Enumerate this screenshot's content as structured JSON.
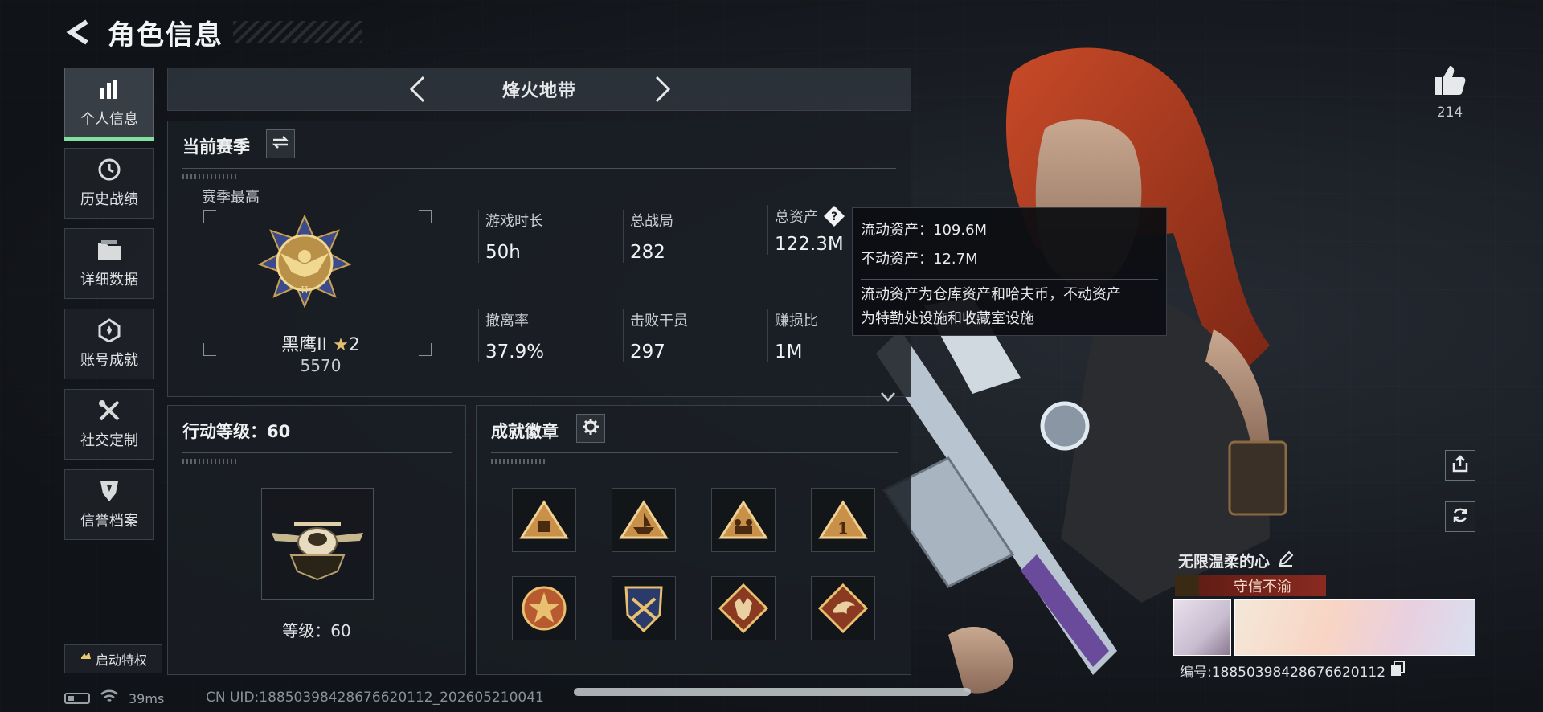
{
  "header": {
    "title": "角色信息"
  },
  "sidebar": {
    "items": [
      {
        "label": "个人信息",
        "icon": "bar-chart-icon",
        "active": true
      },
      {
        "label": "历史战绩",
        "icon": "history-icon"
      },
      {
        "label": "详细数据",
        "icon": "folder-icon"
      },
      {
        "label": "账号成就",
        "icon": "medal-icon"
      },
      {
        "label": "社交定制",
        "icon": "tools-icon"
      },
      {
        "label": "信誉档案",
        "icon": "shield-icon"
      }
    ],
    "privilege_label": "启动特权"
  },
  "mode": {
    "title": "烽火地带"
  },
  "season": {
    "title": "当前赛季",
    "best_label": "赛季最高",
    "rank_name": "黑鹰II",
    "rank_stars": "2",
    "rank_score": "5570",
    "stats": [
      {
        "label": "游戏时长",
        "value": "50h"
      },
      {
        "label": "总战局",
        "value": "282"
      },
      {
        "label": "总资产",
        "value": "122.3M",
        "has_help": true
      },
      {
        "label": "撤离率",
        "value": "37.9%"
      },
      {
        "label": "击败干员",
        "value": "297"
      },
      {
        "label": "赚损比",
        "value": "1M"
      }
    ]
  },
  "tooltip": {
    "liquid": "流动资产：109.6M",
    "fixed": "不动资产：12.7M",
    "note_line1": "流动资产为仓库资产和哈夫币，不动资产",
    "note_line2": "为特勤处设施和收藏室设施"
  },
  "action_level": {
    "title": "行动等级：60",
    "level_text": "等级：60"
  },
  "achievements": {
    "title": "成就徽章"
  },
  "right": {
    "likes": "214"
  },
  "player": {
    "name": "无限温柔的心",
    "title_label": "守信不渝",
    "id_text": "编号:1885039842867662011​2"
  },
  "status": {
    "ping": "39ms",
    "uid": "CN UID:1885039842867662011​2_202605210041"
  },
  "colors": {
    "accent_green": "#7fe0a0",
    "title_red": "#8a2a20",
    "gold": "#c8a050"
  }
}
